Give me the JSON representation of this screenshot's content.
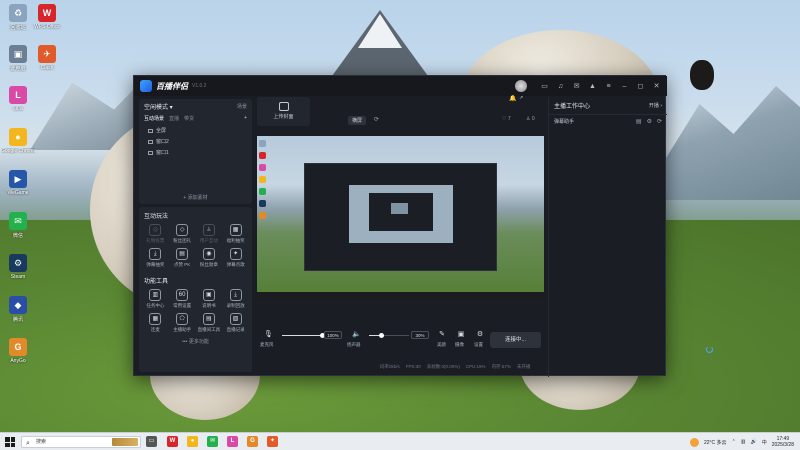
{
  "desktop": {
    "icons": [
      {
        "label": "回收站",
        "color": "#8aa4c0",
        "glyph": "♻"
      },
      {
        "label": "WPS Office",
        "color": "#d6262b",
        "glyph": "W"
      },
      {
        "label": "此电脑",
        "color": "#6b7f95",
        "glyph": "▣"
      },
      {
        "label": "Clash",
        "color": "#e05a2a",
        "glyph": "✈"
      },
      {
        "label": "LiLa",
        "color": "#d84aa6",
        "glyph": "L"
      },
      {
        "label": "Google Chrome",
        "color": "#f3b61c",
        "glyph": "●"
      },
      {
        "label": "WeGame",
        "color": "#2656a8",
        "glyph": "▶"
      },
      {
        "label": "微信",
        "color": "#22b14c",
        "glyph": "✉"
      },
      {
        "label": "Steam",
        "color": "#173a5e",
        "glyph": "⚙"
      },
      {
        "label": "腾讯",
        "color": "#2a4ea6",
        "glyph": "◆"
      },
      {
        "label": "AnyGo",
        "color": "#e08a2a",
        "glyph": "G"
      }
    ]
  },
  "app": {
    "title": "百播伴侣",
    "version": "V1.0.2",
    "titlebar_icons": [
      "avatar-icon",
      "message-icon",
      "headset-icon",
      "mail-icon",
      "shirt-icon",
      "menu-icon",
      "minimize-icon",
      "maximize-icon",
      "close-icon"
    ],
    "scene": {
      "header": "空闲模式",
      "header_right": "场景",
      "tabs": [
        "互动场景",
        "直播",
        "带货"
      ],
      "add": "+",
      "sources": [
        "全屏",
        "窗口2",
        "窗口1"
      ],
      "add_source": "+ 添加素材"
    },
    "interaction": {
      "title": "互动玩法",
      "tools": [
        {
          "label": "礼物投票",
          "glyph": "◎",
          "enabled": false
        },
        {
          "label": "粉丝团礼",
          "glyph": "◇",
          "enabled": true
        },
        {
          "label": "用户互动",
          "glyph": "♟",
          "enabled": false
        },
        {
          "label": "福利抽奖",
          "glyph": "▦",
          "enabled": true
        },
        {
          "label": "弹幕抽奖",
          "glyph": "⤓",
          "enabled": true
        },
        {
          "label": "点赞 PK",
          "glyph": "▤",
          "enabled": true
        },
        {
          "label": "粉丝勋章",
          "glyph": "◉",
          "enabled": true
        },
        {
          "label": "弹幕点歌",
          "glyph": "✦",
          "enabled": true
        }
      ]
    },
    "tools_section": {
      "title": "功能工具",
      "tools": [
        {
          "label": "任务中心",
          "glyph": "▥"
        },
        {
          "label": "常用设置",
          "glyph": "60"
        },
        {
          "label": "说明书",
          "glyph": "▣"
        },
        {
          "label": "录制回放",
          "glyph": "⤓"
        },
        {
          "label": "连麦",
          "glyph": "▦"
        },
        {
          "label": "主播助手",
          "glyph": "⬠"
        },
        {
          "label": "直播间工具",
          "glyph": "▤"
        },
        {
          "label": "直播记录",
          "glyph": "▧"
        }
      ],
      "more": "••• 更多功能"
    },
    "upload": {
      "label": "上传封面"
    },
    "orientation": "横屏",
    "likes": "7",
    "viewers": "0",
    "controls": {
      "mic_label": "麦克风",
      "mic_volume": "100%",
      "mic_level": 1.0,
      "speaker_label": "扬声器",
      "speaker_volume": "30%",
      "speaker_level": 0.3,
      "beauty_label": "美颜",
      "camera_label": "摄像",
      "settings_label": "设置",
      "connect_button": "连接中..."
    },
    "status": [
      "码率0kb/s",
      "FPS:30",
      "丢帧数:0(0.00%)",
      "CPU:19%",
      "内存:67%",
      "未开播"
    ],
    "right_panel": {
      "title": "主播工作中心",
      "title_right": "开播",
      "sub_title": "弹幕助手",
      "sub_icons": [
        "filter-icon",
        "settings-icon",
        "refresh-icon"
      ]
    }
  },
  "taskbar": {
    "search_placeholder": "搜索",
    "apps": [
      {
        "name": "task-view",
        "color": "#555",
        "glyph": "▭"
      },
      {
        "name": "wps",
        "color": "#d6262b",
        "glyph": "W"
      },
      {
        "name": "chrome",
        "color": "#f3b61c",
        "glyph": "●"
      },
      {
        "name": "wechat",
        "color": "#22b14c",
        "glyph": "✉"
      },
      {
        "name": "lila",
        "color": "#d84aa6",
        "glyph": "L"
      },
      {
        "name": "anygo",
        "color": "#e08a2a",
        "glyph": "G"
      },
      {
        "name": "app",
        "color": "#e05a2a",
        "glyph": "✦"
      }
    ],
    "weather": "22°C 多云",
    "time": "17:49",
    "date": "2025/3/28"
  }
}
